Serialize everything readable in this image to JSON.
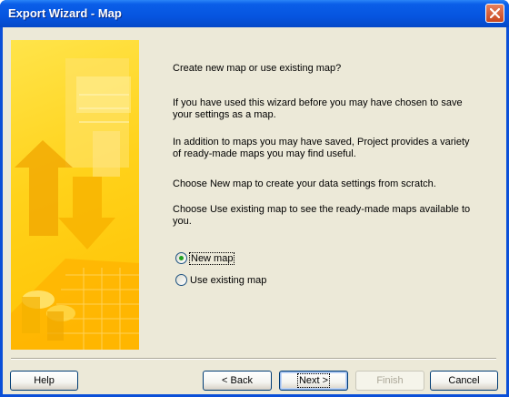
{
  "window": {
    "title": "Export Wizard - Map"
  },
  "content": {
    "question": "Create new map or use existing map?",
    "para1": "If you have used this wizard before you may have chosen to save your settings as a map.",
    "para2": "In addition to maps you may have saved, Project provides a variety of ready-made maps you may find useful.",
    "para3": "Choose New map to create your data settings from scratch.",
    "para4": "Choose Use existing map to see the ready-made maps available to you."
  },
  "options": [
    {
      "label": "New map",
      "checked": true
    },
    {
      "label": "Use existing map",
      "checked": false
    }
  ],
  "buttons": {
    "help": "Help",
    "back": "< Back",
    "next": "Next >",
    "finish": "Finish",
    "cancel": "Cancel"
  },
  "colors": {
    "title_bar": "#0655e0",
    "dialog_bg": "#ece9d8",
    "hero": "#ffc000"
  },
  "icons": {
    "close": "close-icon",
    "banner": "wizard-banner-image"
  }
}
